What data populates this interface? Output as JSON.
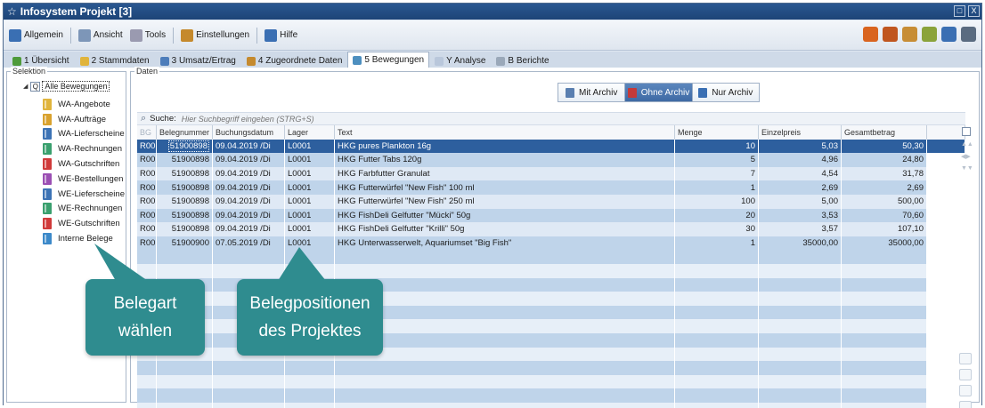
{
  "window": {
    "title": "Infosystem Projekt [3]",
    "btn_restore": "□",
    "btn_close": "X"
  },
  "menu": {
    "items": [
      {
        "label": "Allgemein",
        "icon": "arrow-icon",
        "color": "#3a6fb3"
      },
      {
        "label": "Ansicht",
        "icon": "people-icon",
        "color": "#7d96b8"
      },
      {
        "label": "Tools",
        "icon": "tools-icon",
        "color": "#9a9ab0"
      },
      {
        "label": "Einstellungen",
        "icon": "settings-icon",
        "color": "#c5892c"
      },
      {
        "label": "Hilfe",
        "icon": "help-icon",
        "color": "#3a6fb3"
      }
    ],
    "right_icons": [
      "#d9641f",
      "#c0561f",
      "#c78d35",
      "#8aa33a",
      "#3a6fb3",
      "#5a6b80"
    ]
  },
  "tabs": [
    {
      "label": "1 Übersicht",
      "color": "#4e9a3a"
    },
    {
      "label": "2 Stammdaten",
      "color": "#e0b43c"
    },
    {
      "label": "3 Umsatz/Ertrag",
      "color": "#4d7dba"
    },
    {
      "label": "4 Zugeordnete Daten",
      "color": "#c58a2e"
    },
    {
      "label": "5 Bewegungen",
      "color": "#4d8fbf",
      "active": true
    },
    {
      "label": "Y Analyse",
      "color": "#b9c7db"
    },
    {
      "label": "B Berichte",
      "color": "#9aa8b9"
    }
  ],
  "selektion": {
    "label": "Selektion",
    "root_label": "Alle Bewegungen",
    "root_icon": "Q",
    "items": [
      {
        "label": "WA-Angebote",
        "color": "#e0b43c"
      },
      {
        "label": "WA-Aufträge",
        "color": "#d9a22e"
      },
      {
        "label": "WA-Lieferscheine",
        "color": "#3c73b5"
      },
      {
        "label": "WA-Rechnungen",
        "color": "#3aa06e"
      },
      {
        "label": "WA-Gutschriften",
        "color": "#d03a3a"
      },
      {
        "label": "WE-Bestellungen",
        "color": "#9b4fb3"
      },
      {
        "label": "WE-Lieferscheine",
        "color": "#3c73b5"
      },
      {
        "label": "WE-Rechnungen",
        "color": "#3aa06e"
      },
      {
        "label": "WE-Gutschriften",
        "color": "#d03a3a"
      },
      {
        "label": "Interne Belege",
        "color": "#3c89c9"
      }
    ]
  },
  "daten": {
    "label": "Daten",
    "filters": [
      {
        "label": "Mit Archiv",
        "color": "#5a7fb0"
      },
      {
        "label": "Ohne Archiv",
        "color": "#c43a3a",
        "active": true
      },
      {
        "label": "Nur Archiv",
        "color": "#3a6fb3"
      }
    ],
    "search_label": "Suche:",
    "search_placeholder": "Hier Suchbegriff eingeben (STRG+S)",
    "columns": [
      "BG",
      "Belegnummer",
      "Buchungsdatum",
      "Lager",
      "Text",
      "Menge",
      "Einzelpreis",
      "Gesamtbetrag"
    ],
    "rows": [
      [
        "R00",
        "51900898",
        "09.04.2019 /Di",
        "L0001",
        "HKG pures Plankton 16g",
        "10",
        "5,03",
        "50,30"
      ],
      [
        "R00",
        "51900898",
        "09.04.2019 /Di",
        "L0001",
        "HKG Futter Tabs 120g",
        "5",
        "4,96",
        "24,80"
      ],
      [
        "R00",
        "51900898",
        "09.04.2019 /Di",
        "L0001",
        "HKG Farbfutter Granulat",
        "7",
        "4,54",
        "31,78"
      ],
      [
        "R00",
        "51900898",
        "09.04.2019 /Di",
        "L0001",
        "HKG Futterwürfel \"New Fish\" 100 ml",
        "1",
        "2,69",
        "2,69"
      ],
      [
        "R00",
        "51900898",
        "09.04.2019 /Di",
        "L0001",
        "HKG Futterwürfel \"New Fish\" 250 ml",
        "100",
        "5,00",
        "500,00"
      ],
      [
        "R00",
        "51900898",
        "09.04.2019 /Di",
        "L0001",
        "HKG FishDeli Gelfutter \"Mücki\" 50g",
        "20",
        "3,53",
        "70,60"
      ],
      [
        "R00",
        "51900898",
        "09.04.2019 /Di",
        "L0001",
        "HKG FishDeli Gelfutter \"Krilli\" 50g",
        "30",
        "3,57",
        "107,10"
      ],
      [
        "R00",
        "51900900",
        "07.05.2019 /Di",
        "L0001",
        "HKG Unterwasserwelt, Aquariumset \"Big Fish\"",
        "1",
        "35000,00",
        "35000,00"
      ]
    ],
    "empty_rows": 12
  },
  "callouts": {
    "belegart": [
      "Belegart",
      "wählen"
    ],
    "belegpositionen": [
      "Belegpositionen",
      "des Projektes"
    ]
  }
}
